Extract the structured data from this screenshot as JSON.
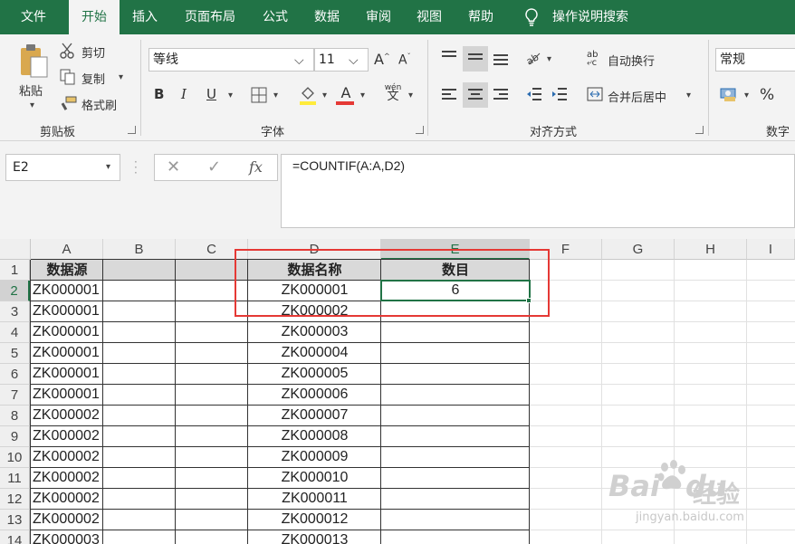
{
  "menubar": {
    "tabs": [
      "文件",
      "开始",
      "插入",
      "页面布局",
      "公式",
      "数据",
      "审阅",
      "视图",
      "帮助"
    ],
    "search_label": "操作说明搜索"
  },
  "clipboard": {
    "paste": "粘贴",
    "cut": "剪切",
    "copy": "复制",
    "format_painter": "格式刷",
    "group": "剪贴板"
  },
  "font": {
    "name": "等线",
    "size": "11",
    "bold": "B",
    "italic": "I",
    "underline": "U",
    "color_letter": "A",
    "phonetic": "wén",
    "phonetic_char": "文",
    "group": "字体",
    "grow": "A",
    "shrink": "A"
  },
  "alignment": {
    "wrap": "自动换行",
    "merge": "合并后居中",
    "group": "对齐方式",
    "wrap_icon": "ab"
  },
  "number": {
    "format": "常规",
    "percent": "%",
    "group": "数字"
  },
  "formula_bar": {
    "name_box": "E2",
    "cancel": "✕",
    "enter": "✓",
    "fx": "fx",
    "formula": "=COUNTIF(A:A,D2)"
  },
  "columns": [
    "A",
    "B",
    "C",
    "D",
    "E",
    "F",
    "G",
    "H",
    "I"
  ],
  "rows": [
    "1",
    "2",
    "3",
    "4",
    "5",
    "6",
    "7",
    "8",
    "9",
    "10",
    "11",
    "12",
    "13",
    "14"
  ],
  "col_a": [
    "数据源",
    "ZK000001",
    "ZK000001",
    "ZK000001",
    "ZK000001",
    "ZK000001",
    "ZK000001",
    "ZK000002",
    "ZK000002",
    "ZK000002",
    "ZK000002",
    "ZK000002",
    "ZK000002",
    "ZK000003"
  ],
  "col_d": [
    "数据名称",
    "ZK000001",
    "ZK000002",
    "ZK000003",
    "ZK000004",
    "ZK000005",
    "ZK000006",
    "ZK000007",
    "ZK000008",
    "ZK000009",
    "ZK000010",
    "ZK000011",
    "ZK000012",
    "ZK000013"
  ],
  "col_e": [
    "数目",
    "6"
  ],
  "watermark": {
    "brand": "Bai",
    "brand2": "du",
    "sub": "经验",
    "url": "jingyan.baidu.com"
  },
  "colors": {
    "excel_green": "#217346",
    "highlight_red": "#e53935",
    "header_fill": "#d9d9d9"
  }
}
